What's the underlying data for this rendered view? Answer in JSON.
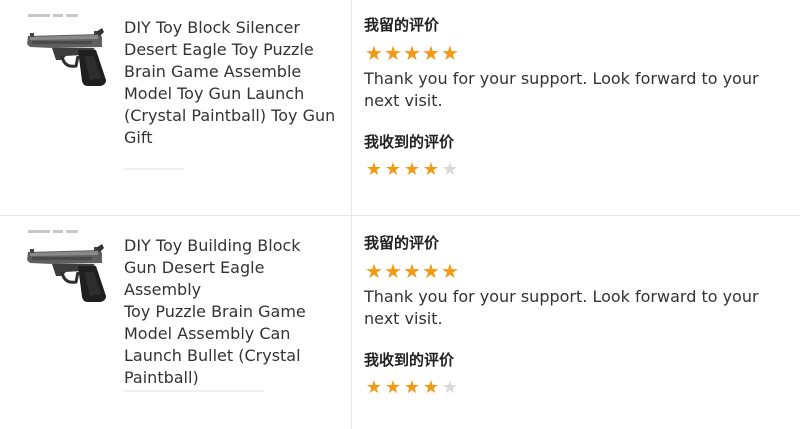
{
  "colors": {
    "star_filled": "#f29a16",
    "star_empty": "#d9d9d9",
    "divider": "#e6e6e6"
  },
  "reviews": [
    {
      "product_title": "DIY Toy Block Silencer\nDesert Eagle Toy Puzzle\nBrain Game Assemble\nModel Toy Gun Launch\n(Crystal Paintball) Toy Gun\nGift",
      "thumbnail_icon": "pistol-image",
      "my_review_heading": "我留的评价",
      "my_rating": 5,
      "reply_text": "Thank you for your support. Look forward to your next visit.",
      "received_heading": "我收到的评价",
      "received_rating": 4
    },
    {
      "product_title": "DIY Toy Building Block\nGun Desert Eagle Assembly\nToy Puzzle Brain Game\nModel Assembly Can\nLaunch Bullet (Crystal\nPaintball)",
      "thumbnail_icon": "pistol-image",
      "my_review_heading": "我留的评价",
      "my_rating": 5,
      "reply_text": "Thank you for your support. Look forward to your next visit.",
      "received_heading": "我收到的评价",
      "received_rating": 4
    }
  ],
  "rating_max": 5
}
